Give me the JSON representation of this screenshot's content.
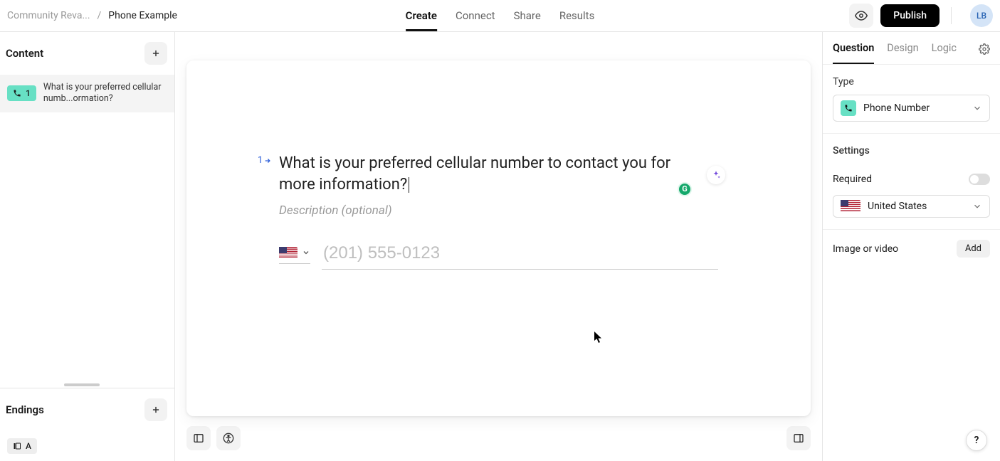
{
  "breadcrumb": {
    "project": "Community Reva...",
    "separator": "/",
    "form": "Phone Example"
  },
  "topnav": {
    "create": "Create",
    "connect": "Connect",
    "share": "Share",
    "results": "Results"
  },
  "topright": {
    "publish": "Publish",
    "avatar": "LB"
  },
  "sidebar": {
    "content_title": "Content",
    "q1_number": "1",
    "q1_text": "What is your preferred cellular numb...ormation?",
    "endings_title": "Endings",
    "ending_a": "A"
  },
  "canvas": {
    "qnum": "1",
    "title": "What is your preferred cellular number to contact you for more information?",
    "description_placeholder": "Description (optional)",
    "phone_placeholder": "(201) 555-0123",
    "grammarly": "G"
  },
  "right": {
    "tabs": {
      "question": "Question",
      "design": "Design",
      "logic": "Logic"
    },
    "type_label": "Type",
    "type_value": "Phone Number",
    "settings_label": "Settings",
    "required_label": "Required",
    "country_value": "United States",
    "media_label": "Image or video",
    "add_label": "Add"
  },
  "help": "?",
  "colors": {
    "accent_teal": "#67e0c4",
    "link_blue": "#2c5ed9"
  }
}
